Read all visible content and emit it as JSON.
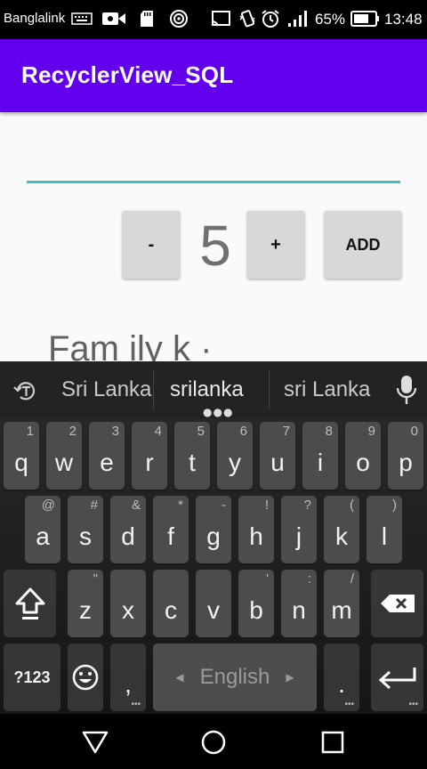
{
  "status_bar": {
    "carrier": "Banglalink",
    "battery": "65%",
    "time": "13:48"
  },
  "app_bar": {
    "title": "RecyclerView_SQL"
  },
  "form": {
    "input_value": "",
    "minus_label": "-",
    "quantity": "5",
    "plus_label": "+",
    "add_label": "ADD",
    "partial_item_text": "Fam ily k     ·"
  },
  "keyboard": {
    "suggestions": [
      "Sri Lanka",
      "srilanka",
      "sri Lanka"
    ],
    "row1": [
      {
        "c": "q",
        "h": "1"
      },
      {
        "c": "w",
        "h": "2"
      },
      {
        "c": "e",
        "h": "3"
      },
      {
        "c": "r",
        "h": "4"
      },
      {
        "c": "t",
        "h": "5"
      },
      {
        "c": "y",
        "h": "6"
      },
      {
        "c": "u",
        "h": "7"
      },
      {
        "c": "i",
        "h": "8"
      },
      {
        "c": "o",
        "h": "9"
      },
      {
        "c": "p",
        "h": "0"
      }
    ],
    "row2": [
      {
        "c": "a",
        "h": "@"
      },
      {
        "c": "s",
        "h": "#"
      },
      {
        "c": "d",
        "h": "&"
      },
      {
        "c": "f",
        "h": "*"
      },
      {
        "c": "g",
        "h": "-"
      },
      {
        "c": "h",
        "h": "!"
      },
      {
        "c": "j",
        "h": "?"
      },
      {
        "c": "k",
        "h": "("
      },
      {
        "c": "l",
        "h": ")"
      }
    ],
    "row3": [
      {
        "c": "z",
        "h": "\""
      },
      {
        "c": "x",
        "h": ""
      },
      {
        "c": "c",
        "h": ""
      },
      {
        "c": "v",
        "h": ""
      },
      {
        "c": "b",
        "h": "'"
      },
      {
        "c": "n",
        "h": ":"
      },
      {
        "c": "m",
        "h": "/"
      }
    ],
    "symbols_label": "?123",
    "comma": ",",
    "space_label": "English",
    "period": "."
  },
  "colors": {
    "app_bar": "#6200EE",
    "input_underline": "#3bbfbf",
    "button": "#d8d8d8"
  }
}
